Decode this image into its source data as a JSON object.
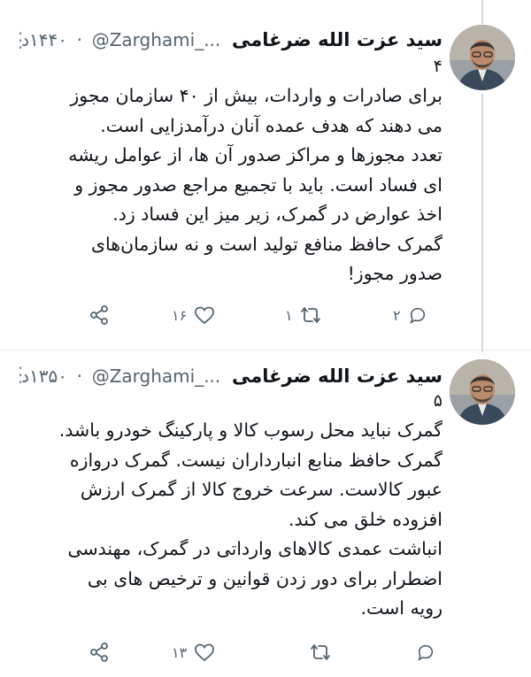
{
  "tweets": [
    {
      "author_name": "سید عزت الله ضرغامی",
      "author_handle": "@Zarghami_...",
      "time": "۱۴۴۰د",
      "thread_number": "۴",
      "text": "برای صادرات و واردات، بیش از ۴۰ سازمان مجوز\nمی دهند که هدف عمده آنان درآمدزایی است.\nتعدد مجوزها و مراکز صدور آن ها، از عوامل ریشه\nای فساد است. باید با تجمیع مراجع صدور مجوز و\nاخذ عوارض در گمرک، زیر میز این فساد زد.\nگمرک حافظ منافع تولید است و نه سازمان‌های\nصدور مجوز!",
      "reply_count": "۲",
      "retweet_count": "۱",
      "like_count": "۱۶"
    },
    {
      "author_name": "سید عزت الله ضرغامی",
      "author_handle": "@Zarghami_...",
      "time": "۱۳۵۰د",
      "thread_number": "۵",
      "text": "گمرک نباید محل رسوب کالا و پارکینگ خودرو باشد.\nگمرک حافظ منابع انبارداران نیست. گمرک دروازه\nعبور کالاست. سرعت خروج کالا از گمرک ارزش\nافزوده خلق می کند.\nانباشت عمدی کالاهای وارداتی در گمرک، مهندسی\nاضطرار برای دور زدن قوانین و ترخیص های بی\nرویه است.",
      "reply_count": "",
      "retweet_count": "",
      "like_count": "۱۳"
    }
  ],
  "icons": {
    "reply": "reply-icon",
    "retweet": "retweet-icon",
    "like": "heart-icon",
    "share": "share-icon",
    "more": "more-icon"
  },
  "colors": {
    "text": "#0f1419",
    "secondary": "#536471",
    "thread_line": "#cfd9de"
  }
}
